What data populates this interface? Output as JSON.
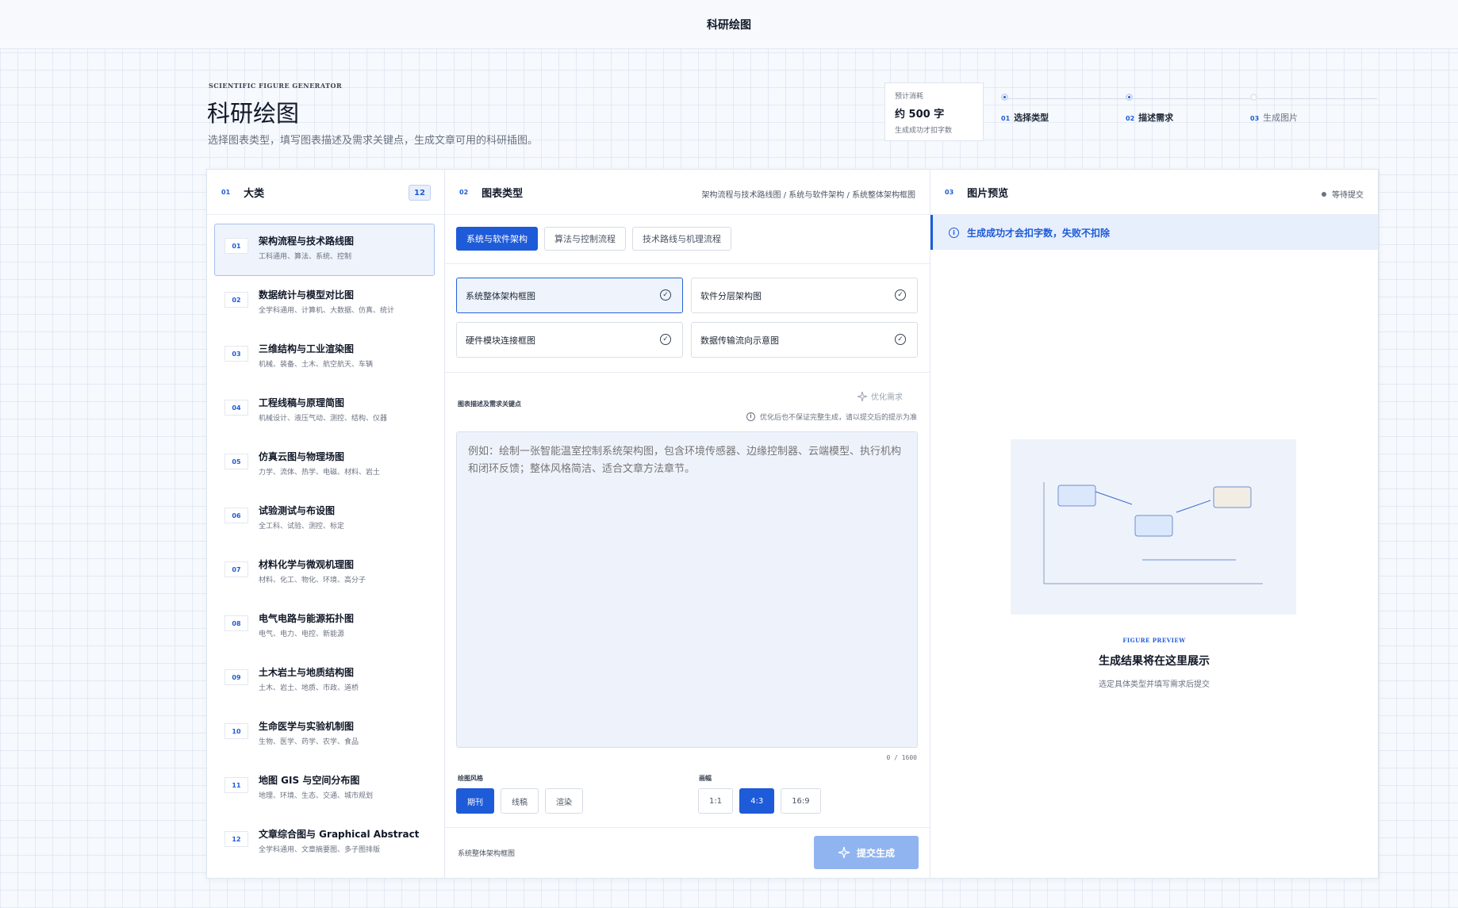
{
  "app": {
    "title": "科研绘图"
  },
  "hero": {
    "eyebrow": "SCIENTIFIC FIGURE GENERATOR",
    "title": "科研绘图",
    "subtitle": "选择图表类型，填写图表描述及需求关键点，生成文章可用的科研插图。"
  },
  "cost": {
    "label": "预计消耗",
    "value": "约 500 字",
    "note": "生成成功才扣字数"
  },
  "steps": [
    {
      "num": "01",
      "label": "选择类型"
    },
    {
      "num": "02",
      "label": "描述需求"
    },
    {
      "num": "03",
      "label": "生成图片"
    }
  ],
  "categories": {
    "num": "01",
    "title": "大类",
    "count": "12",
    "items": [
      {
        "idx": "01",
        "title": "架构流程与技术路线图",
        "sub": "工科通用、算法、系统、控制"
      },
      {
        "idx": "02",
        "title": "数据统计与模型对比图",
        "sub": "全学科通用、计算机、大数据、仿真、统计"
      },
      {
        "idx": "03",
        "title": "三维结构与工业渲染图",
        "sub": "机械、装备、土木、航空航天、车辆"
      },
      {
        "idx": "04",
        "title": "工程线稿与原理简图",
        "sub": "机械设计、液压气动、测控、结构、仪器"
      },
      {
        "idx": "05",
        "title": "仿真云图与物理场图",
        "sub": "力学、流体、热学、电磁、材料、岩土"
      },
      {
        "idx": "06",
        "title": "试验测试与布设图",
        "sub": "全工科、试验、测控、标定"
      },
      {
        "idx": "07",
        "title": "材料化学与微观机理图",
        "sub": "材料、化工、物化、环境、高分子"
      },
      {
        "idx": "08",
        "title": "电气电路与能源拓扑图",
        "sub": "电气、电力、电控、新能源"
      },
      {
        "idx": "09",
        "title": "土木岩土与地质结构图",
        "sub": "土木、岩土、地质、市政、道桥"
      },
      {
        "idx": "10",
        "title": "生命医学与实验机制图",
        "sub": "生物、医学、药学、农学、食品"
      },
      {
        "idx": "11",
        "title": "地图 GIS 与空间分布图",
        "sub": "地理、环境、生态、交通、城市规划"
      },
      {
        "idx": "12",
        "title": "文章综合图与 Graphical Abstract",
        "sub": "全学科通用、文章摘要图、多子图排版"
      }
    ]
  },
  "chart_types": {
    "num": "02",
    "title": "图表类型",
    "breadcrumb": "架构流程与技术路线图 / 系统与软件架构 / 系统整体架构框图",
    "tabs": [
      "系统与软件架构",
      "算法与控制流程",
      "技术路线与机理流程"
    ],
    "types": [
      "系统整体架构框图",
      "软件分层架构图",
      "硬件模块连接框图",
      "数据传输流向示意图"
    ],
    "optimize_label": "优化需求",
    "desc_label": "图表描述及需求关键点",
    "desc_hint": "优化后也不保证完整生成，请以提交后的提示为准",
    "desc_placeholder": "例如：绘制一张智能温室控制系统架构图，包含环境传感器、边缘控制器、云端模型、执行机构和闭环反馈；整体风格简洁、适合文章方法章节。",
    "counter": "0 / 1600",
    "style_label": "绘图风格",
    "styles": [
      "期刊",
      "线稿",
      "渲染"
    ],
    "ratio_label": "画幅",
    "ratios": [
      "1:1",
      "4:3",
      "16:9"
    ],
    "selected_label": "系统整体架构框图",
    "submit_label": "提交生成"
  },
  "preview": {
    "num": "03",
    "title": "图片预览",
    "status": "等待提交",
    "notice": "生成成功才会扣字数，失败不扣除",
    "eyebrow": "FIGURE PREVIEW",
    "headline": "生成结果将在这里展示",
    "sub": "选定具体类型并填写需求后提交"
  },
  "colors": {
    "accent": "#1d5bd8",
    "submit_disabled": "#90b4f0",
    "tint": "#eef3fb"
  }
}
